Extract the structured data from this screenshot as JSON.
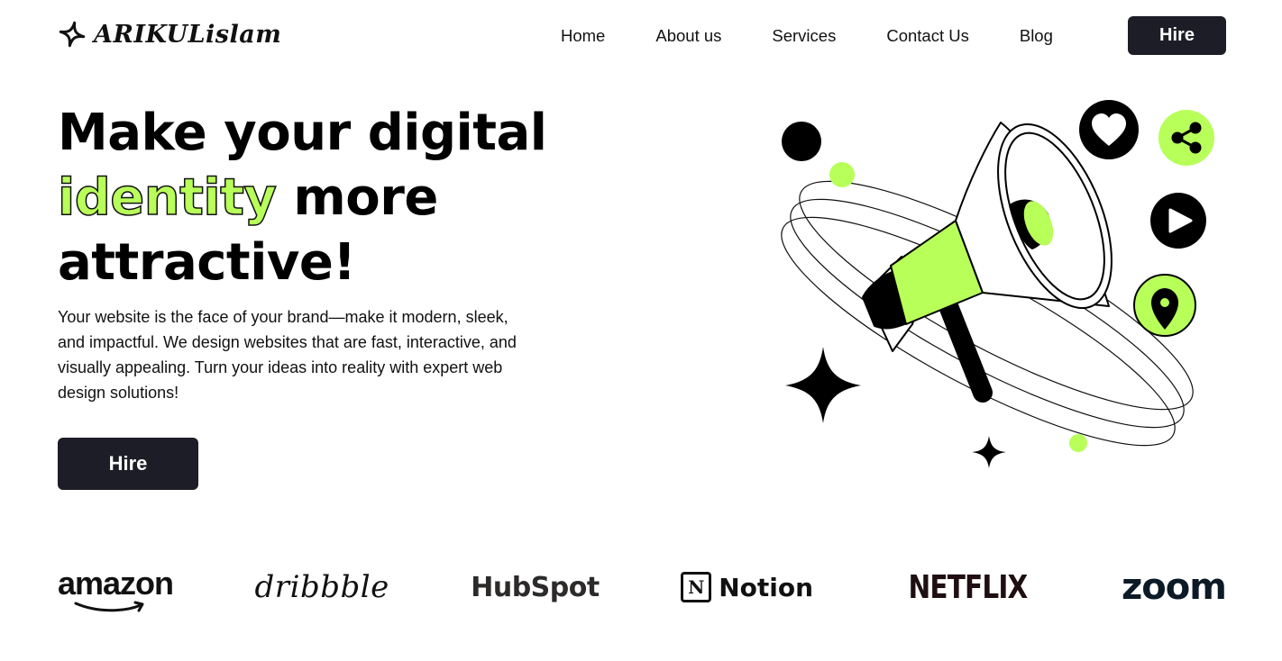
{
  "colors": {
    "accent": "#b8ff5a",
    "dark": "#1c1d26",
    "text": "#111111",
    "background": "#ffffff"
  },
  "header": {
    "logo_icon": "sparkle-outline-icon",
    "logo_text": "ARIKULislam",
    "nav": [
      {
        "label": "Home"
      },
      {
        "label": "About us"
      },
      {
        "label": "Services"
      },
      {
        "label": "Contact Us"
      },
      {
        "label": "Blog"
      }
    ],
    "hire_label": "Hire"
  },
  "hero": {
    "headline_part1": "Make your digital",
    "headline_accent": "identity",
    "headline_part2": "more attractive!",
    "description": "Your website is the face of your brand—make it modern, sleek, and impactful. We design websites that are fast, interactive, and visually appealing. Turn your ideas into reality with expert web design solutions!",
    "hire_label": "Hire",
    "illustration_icons": [
      "megaphone-icon",
      "heart-icon",
      "share-icon",
      "play-icon",
      "location-pin-icon",
      "sparkle-star-icon"
    ]
  },
  "brands": [
    {
      "name": "amazon"
    },
    {
      "name": "dribbble"
    },
    {
      "name": "HubSpot"
    },
    {
      "name": "Notion"
    },
    {
      "name": "NETFLIX"
    },
    {
      "name": "zoom"
    }
  ]
}
